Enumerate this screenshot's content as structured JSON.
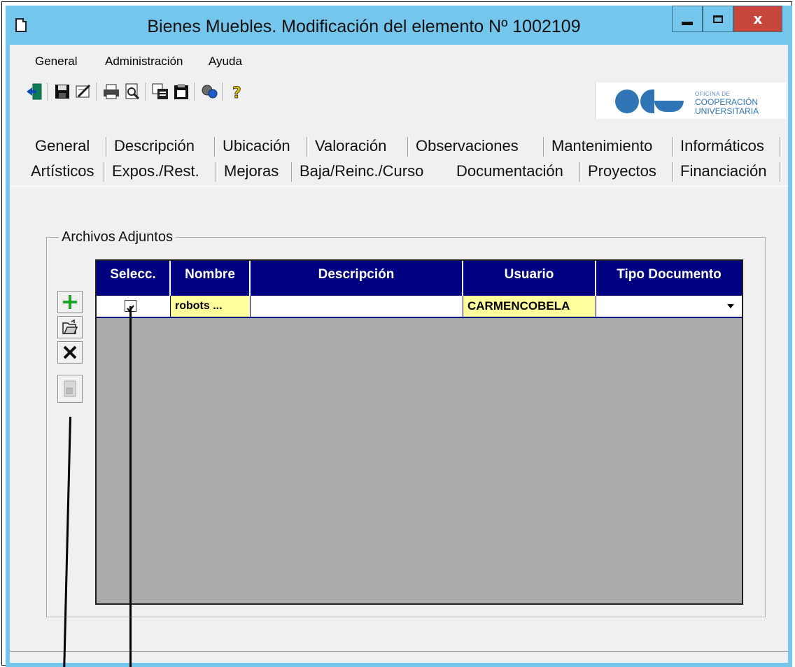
{
  "window": {
    "title": "Bienes Muebles. Modificación del elemento Nº 1002109",
    "close_label": "x"
  },
  "menu": [
    "General",
    "Administración",
    "Ayuda"
  ],
  "toolbar": {
    "icons": [
      "exit-icon",
      "save-icon",
      "edit-icon",
      "print-icon",
      "print-preview-icon",
      "copy-icon",
      "paste-icon",
      "search-icon",
      "help-icon"
    ]
  },
  "logo": {
    "small": "OFICINA DE",
    "line1": "COOPERACIÓN",
    "line2": "UNIVERSITARIA"
  },
  "tabs": {
    "row1": [
      "General",
      "Descripción",
      "Ubicación",
      "Valoración",
      "Observaciones",
      "Mantenimiento",
      "Informáticos"
    ],
    "row2": [
      "Artísticos",
      "Expos./Rest.",
      "Mejoras",
      "Baja/Reinc./Curso",
      "Documentación",
      "Proyectos",
      "Financiación"
    ],
    "active": "Documentación"
  },
  "attachments": {
    "group_label": "Archivos Adjuntos",
    "columns": [
      "Selecc.",
      "Nombre",
      "Descripción",
      "Usuario",
      "Tipo Documento"
    ],
    "rows": [
      {
        "selected": true,
        "nombre": "robots ...",
        "descripcion": "",
        "usuario": "CARMENCOBELA",
        "tipo": ""
      }
    ]
  },
  "colors": {
    "title_bar": "#75c6ec",
    "grid_header": "#000080",
    "highlight_cell": "#ffff9c",
    "grid_empty": "#ababab"
  }
}
